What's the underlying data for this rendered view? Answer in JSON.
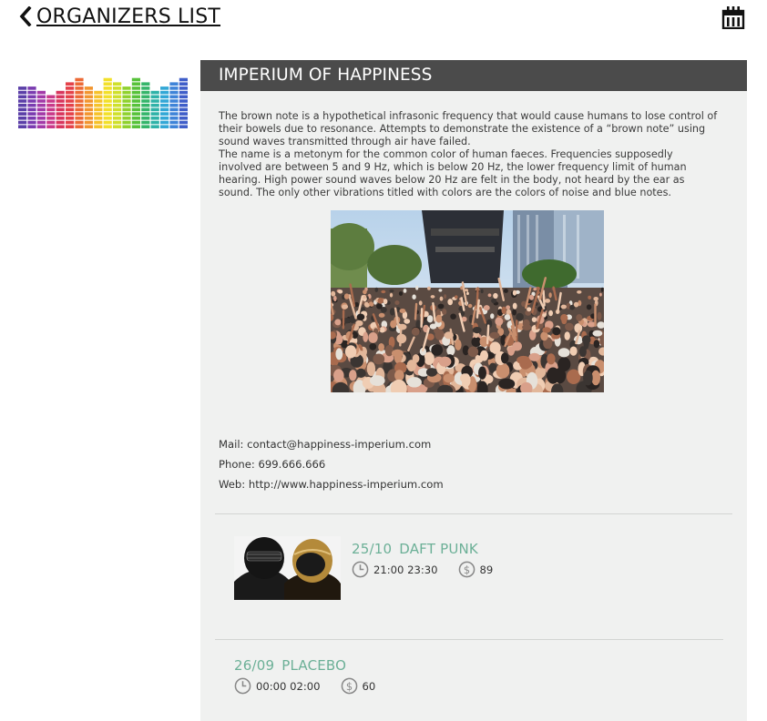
{
  "header": {
    "back_label": "ORGANIZERS LIST"
  },
  "organizer": {
    "name": "IMPERIUM OF HAPPINESS",
    "description_1": "The brown note is a hypothetical infrasonic frequency that would cause humans to lose control of their bowels due to resonance. Attempts to demonstrate the existence of a “brown note” using sound waves transmitted through air have failed.",
    "description_2": "The name is a metonym for the common color of human faeces. Frequencies supposedly involved are between 5 and 9 Hz, which is below 20 Hz, the lower frequency limit of human hearing. High power sound waves below 20 Hz are felt in the body, not heard by the ear as sound. The only other vibrations titled with colors are the colors of noise and blue notes.",
    "mail": "Mail: contact@happiness-imperium.com",
    "phone": "Phone: 699.666.666",
    "web": "Web: http://www.happiness-imperium.com"
  },
  "events": [
    {
      "date": "25/10",
      "name": "DAFT PUNK",
      "times": "21:00 23:30",
      "price": "89"
    },
    {
      "date": "26/09",
      "name": "PLACEBO",
      "times": "00:00 02:00",
      "price": "60"
    }
  ],
  "colors": {
    "header_bg": "#4b4b4b",
    "panel_bg": "#f0f1f0",
    "accent": "#6cb097"
  },
  "icons": {
    "back": "chevron-left-icon",
    "calendar": "calendar-icon",
    "time": "clock-icon",
    "price": "dollar-icon"
  }
}
